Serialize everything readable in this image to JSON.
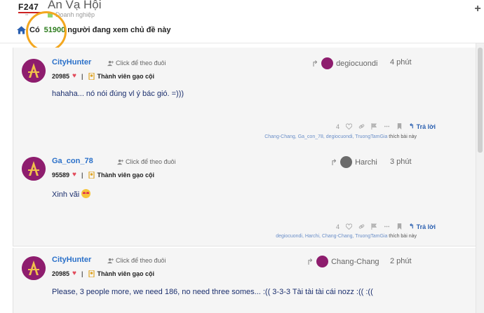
{
  "header": {
    "logo_text": "F247",
    "logo_sub": "vn",
    "site_title": "An Vạ Hội",
    "category": "Doanh nghiệp",
    "category_color": "#92d36e",
    "plus_label": "+",
    "viewers_lead": "Có",
    "viewers_count": "51900",
    "viewers_tail": "người đang xem chủ đề này"
  },
  "colors": {
    "username": "#2a70c9",
    "post_text": "#1b2f6e",
    "highlight": "#f3a71f",
    "count_green": "#2e7d1f"
  },
  "posts": [
    {
      "username": "CityHunter",
      "follow": "Click để theo đuôi",
      "points": "20985",
      "rank": "Thành viên gạo cội",
      "reply_to": "degiocuondi",
      "time": "4 phút",
      "text": "hahaha... nó nói đúng vl ý bác gió. =)))",
      "likes": "4",
      "reply_label": "Trả lời",
      "liked_by": "Chang-Chang, Ga_con_78, degiocuondi, TruongTamGia",
      "liked_suffix": "thích bài này"
    },
    {
      "username": "Ga_con_78",
      "follow": "Click để theo đuôi",
      "points": "95589",
      "rank": "Thành viên gạo cội",
      "reply_to": "Harchi",
      "time": "3 phút",
      "text": "Xinh vãi",
      "likes": "4",
      "reply_label": "Trả lời",
      "liked_by": "degiocuondi, Harchi, Chang-Chang, TruongTamGia",
      "liked_suffix": "thích bài này"
    },
    {
      "username": "CityHunter",
      "follow": "Click để theo đuôi",
      "points": "20985",
      "rank": "Thành viên gạo cội",
      "reply_to": "Chang-Chang",
      "time": "2 phút",
      "text": "Please, 3 people more, we need 186, no need three somes... :(( 3-3-3 Tài tài tài cái nozz :(( :(("
    }
  ],
  "icons": {
    "home": "home-icon",
    "follow": "user-plus-icon",
    "heart": "heart-icon",
    "badge": "medal-icon",
    "reply_arrow": "share-arrow-icon",
    "link": "link-icon",
    "flag": "flag-icon",
    "bookmark": "bookmark-icon",
    "more": "more-icon"
  }
}
